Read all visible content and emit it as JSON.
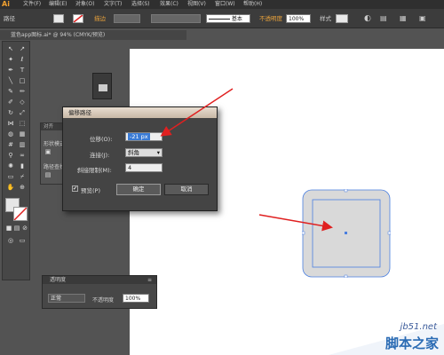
{
  "app": {
    "logo": "Ai"
  },
  "menubar": {
    "items": [
      "文件(F)",
      "编辑(E)",
      "对象(O)",
      "文字(T)",
      "选择(S)",
      "效果(C)",
      "视图(V)",
      "窗口(W)",
      "帮助(H)"
    ]
  },
  "controlbar": {
    "label_path": "路径",
    "stroke_label": "描边",
    "stroke_style": "基本",
    "opacity_label": "不透明度",
    "opacity_value": "100%",
    "style_label": "样式"
  },
  "document": {
    "tab_title": "蓝色app图标.ai* @ 94% (CMYK/预览)"
  },
  "side_panel": {
    "tab": "对齐",
    "lines": [
      "形状模式",
      "路径查找"
    ]
  },
  "dialog": {
    "title": "偏移路径",
    "offset_label": "位移(O):",
    "offset_value": "-21 px",
    "joins_label": "连接(J):",
    "joins_value": "斜角",
    "miter_label": "斜接限制(M):",
    "miter_value": "4",
    "preview_label": "预览(P)",
    "preview_checked": "✔",
    "ok_label": "确定",
    "cancel_label": "取消"
  },
  "transparency_panel": {
    "title": "透明度",
    "blend_mode": "正常",
    "opacity_label": "不透明度",
    "opacity_value": "100%"
  },
  "watermark": {
    "site": "jb51.net",
    "brand": "脚本之家"
  },
  "colors": {
    "arrow": "#e02020",
    "selection": "#4a7fe0",
    "shape_fill": "#d9d9d9"
  }
}
